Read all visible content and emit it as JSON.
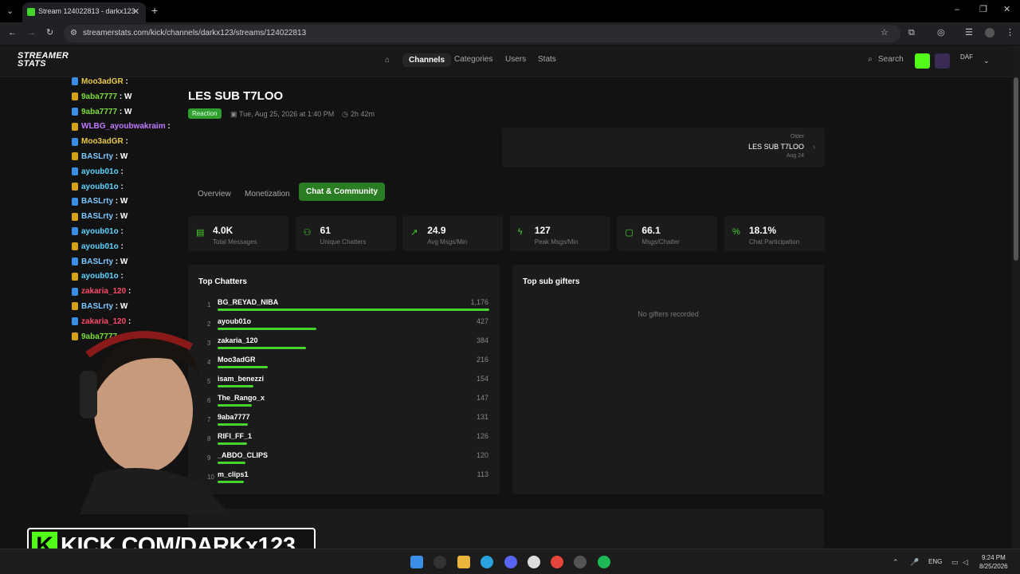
{
  "browser": {
    "tab_title": "Stream 124022813 - darkx123",
    "url": "streamerstats.com/kick/channels/darkx123/streams/124022813"
  },
  "site": {
    "logo_line1": "STREAMER",
    "logo_line2": "STATS",
    "nav": [
      "Channels",
      "Categories",
      "Users",
      "Stats"
    ],
    "search_label": "Search",
    "avatar_text": "DAF"
  },
  "chat_overlay": [
    {
      "user": "Moo3adGR",
      "color": "#e8c94a",
      "msg": ""
    },
    {
      "user": "9aba7777",
      "color": "#7ddc3b",
      "msg": "W"
    },
    {
      "user": "9aba7777",
      "color": "#7ddc3b",
      "msg": "W"
    },
    {
      "user": "WLBG_ayoubwakraim",
      "color": "#c07bff",
      "msg": ""
    },
    {
      "user": "Moo3adGR",
      "color": "#e8c94a",
      "msg": ""
    },
    {
      "user": "BASLrty",
      "color": "#7ec8ff",
      "msg": "W"
    },
    {
      "user": "ayoub01o",
      "color": "#5cd4ff",
      "msg": ""
    },
    {
      "user": "ayoub01o",
      "color": "#5cd4ff",
      "msg": ""
    },
    {
      "user": "BASLrty",
      "color": "#7ec8ff",
      "msg": "W"
    },
    {
      "user": "BASLrty",
      "color": "#7ec8ff",
      "msg": "W"
    },
    {
      "user": "ayoub01o",
      "color": "#5cd4ff",
      "msg": ""
    },
    {
      "user": "ayoub01o",
      "color": "#5cd4ff",
      "msg": ""
    },
    {
      "user": "BASLrty",
      "color": "#7ec8ff",
      "msg": "W"
    },
    {
      "user": "ayoub01o",
      "color": "#5cd4ff",
      "msg": ""
    },
    {
      "user": "zakaria_120",
      "color": "#ff4a6a",
      "msg": ""
    },
    {
      "user": "BASLrty",
      "color": "#7ec8ff",
      "msg": "W"
    },
    {
      "user": "zakaria_120",
      "color": "#ff4a6a",
      "msg": ""
    },
    {
      "user": "9aba7777",
      "color": "#7ddc3b",
      "msg": ""
    }
  ],
  "stream": {
    "title": "LES SUB T7LOO",
    "category": "Reaction",
    "date": "Tue, Aug 25, 2026 at 1:40 PM",
    "duration": "2h 42m"
  },
  "older_stream": {
    "label": "Older",
    "title": "LES SUB T7LOO",
    "date": "Aug 24"
  },
  "tabs": [
    "Overview",
    "Monetization",
    "Chat & Community"
  ],
  "stats": [
    {
      "value": "4.0K",
      "label": "Total Messages",
      "icon": "chat-icon"
    },
    {
      "value": "61",
      "label": "Unique Chatters",
      "icon": "users-icon"
    },
    {
      "value": "24.9",
      "label": "Avg Msgs/Min",
      "icon": "trend-icon"
    },
    {
      "value": "127",
      "label": "Peak Msgs/Min",
      "icon": "bolt-icon"
    },
    {
      "value": "66.1",
      "label": "Msgs/Chatter",
      "icon": "message-icon"
    },
    {
      "value": "18.1%",
      "label": "Chat Participation",
      "icon": "percent-icon"
    }
  ],
  "top_chatters": {
    "title": "Top Chatters",
    "max": 1176,
    "rows": [
      {
        "rank": "1",
        "name": "BG_REYAD_NIBA",
        "count": "1,176",
        "value": 1176
      },
      {
        "rank": "2",
        "name": "ayoub01o",
        "count": "427",
        "value": 427
      },
      {
        "rank": "3",
        "name": "zakaria_120",
        "count": "384",
        "value": 384
      },
      {
        "rank": "4",
        "name": "Moo3adGR",
        "count": "216",
        "value": 216
      },
      {
        "rank": "5",
        "name": "isam_benezzi",
        "count": "154",
        "value": 154
      },
      {
        "rank": "6",
        "name": "The_Rango_x",
        "count": "147",
        "value": 147
      },
      {
        "rank": "7",
        "name": "9aba7777",
        "count": "131",
        "value": 131
      },
      {
        "rank": "8",
        "name": "RIFI_FF_1",
        "count": "126",
        "value": 126
      },
      {
        "rank": "9",
        "name": "_ABDO_CLIPS",
        "count": "120",
        "value": 120
      },
      {
        "rank": "10",
        "name": "m_clips1",
        "count": "113",
        "value": 113
      }
    ]
  },
  "top_gifters": {
    "title": "Top sub gifters",
    "empty": "No gifters recorded"
  },
  "overlay_banner": "KICK.COM/DARKx123",
  "system": {
    "lang": "ENG",
    "time": "9:24 PM",
    "date": "8/25/2026"
  }
}
